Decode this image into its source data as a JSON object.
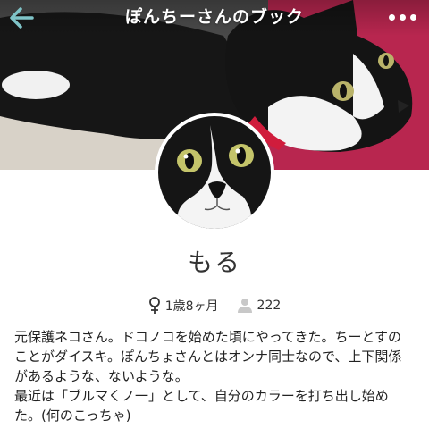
{
  "header": {
    "title": "ぽんちーさんのブック",
    "back_icon": "back-arrow-icon",
    "more_icon": "more-dots-icon",
    "back_color": "#7fc4c8"
  },
  "profile": {
    "name": "もる",
    "gender_icon": "female-icon",
    "age": "1歳8ヶ月",
    "likes_icon": "person-icon",
    "count": "222",
    "bio": "元保護ネコさん。ドコノコを始めた頃にやってきた。ちーとすのことがダイスキ。ぽんちょさんとはオンナ同士なので、上下関係があるような、ないような。\n最近は「ブルマくノ一」として、自分のカラーを打ち出し始めた。(何のこっちゃ)"
  }
}
